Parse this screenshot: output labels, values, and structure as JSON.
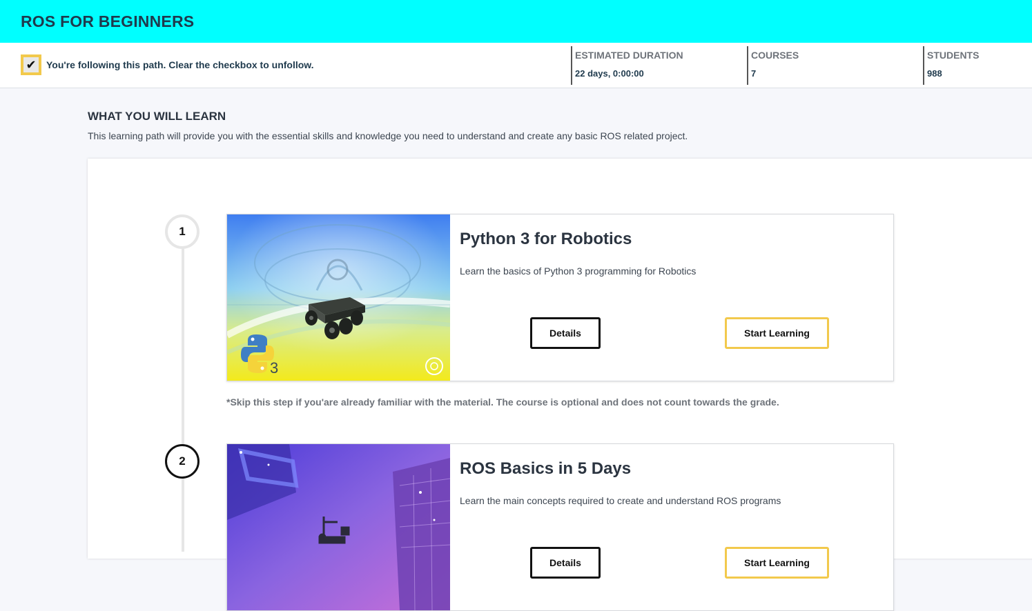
{
  "header": {
    "title": "ROS FOR BEGINNERS"
  },
  "follow": {
    "checked": true,
    "checkmark": "✔",
    "text": "You're following this path. Clear the checkbox to unfollow."
  },
  "stats": [
    {
      "label": "ESTIMATED DURATION",
      "value": "22 days, 0:00:00"
    },
    {
      "label": "COURSES",
      "value": "7"
    },
    {
      "label": "STUDENTS",
      "value": "988"
    }
  ],
  "learn": {
    "title": "WHAT YOU WILL LEARN",
    "description": "This learning path will provide you with the essential skills and knowledge you need to understand and create any basic ROS related project."
  },
  "courses": [
    {
      "step": "1",
      "title": "Python 3 for Robotics",
      "description": "Learn the basics of Python 3 programming for Robotics",
      "details_label": "Details",
      "start_label": "Start Learning",
      "badge_text": "3",
      "note": "*Skip this step if you'are already familiar with the material. The course is optional and does not count towards the grade."
    },
    {
      "step": "2",
      "title": "ROS Basics in 5 Days",
      "description": "Learn the main concepts required to create and understand ROS programs",
      "details_label": "Details",
      "start_label": "Start Learning"
    }
  ],
  "colors": {
    "header_bg": "#00ffff",
    "accent_yellow": "#f2c94c",
    "text_dark": "#1f3a4d"
  }
}
